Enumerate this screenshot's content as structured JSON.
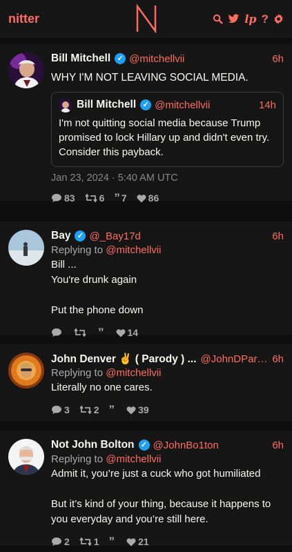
{
  "nav": {
    "brand": "nitter",
    "logo_letter": "N",
    "icons": [
      "search-icon",
      "twitter-bird-icon",
      "lp-icon",
      "help-icon",
      "settings-gear-icon"
    ],
    "lp_label": "lp",
    "help_label": "?"
  },
  "colors": {
    "accent": "#ff6c60",
    "verified": "#1da1f2",
    "bg": "#0f0f0f",
    "card": "#161616"
  },
  "tweets": [
    {
      "fullname": "Bill Mitchell",
      "username": "@mitchellvii",
      "time": "6h",
      "text": "WHY I'M NOT LEAVING SOCIAL MEDIA.",
      "quote": {
        "fullname": "Bill Mitchell",
        "username": "@mitchellvii",
        "time": "14h",
        "text": "I'm not quitting social media because Trump promised to lock Hillary up and didn't even try. Consider this payback."
      },
      "date": "Jan 23, 2024 · 5:40 AM UTC",
      "stats": {
        "replies": "83",
        "retweets": "6",
        "quotes": "7",
        "likes": "86"
      }
    },
    {
      "fullname": "Bay",
      "username": "@_Bay17d",
      "time": "6h",
      "replying_label": "Replying to",
      "replying_to": "@mitchellvii",
      "lines": [
        "Bill ...",
        "You're drunk again",
        "",
        "Put the phone down"
      ],
      "stats": {
        "replies": "",
        "retweets": "",
        "quotes": "",
        "likes": "14"
      }
    },
    {
      "fullname": "John Denver ✌️ ( Parody ) ...",
      "username": "@JohnDParo…",
      "time": "6h",
      "replying_label": "Replying to",
      "replying_to": "@mitchellvii",
      "lines": [
        "Literally no one cares."
      ],
      "stats": {
        "replies": "3",
        "retweets": "2",
        "quotes": "",
        "likes": "39"
      }
    },
    {
      "fullname": "Not John Bolton",
      "username": "@JohnBo1ton",
      "time": "6h",
      "replying_label": "Replying to",
      "replying_to": "@mitchellvii",
      "lines": [
        "Admit it, you’re just a cuck who got humiliated",
        "",
        "But it’s kind of your thing, because it happens to you everyday and you’re still here."
      ],
      "stats": {
        "replies": "2",
        "retweets": "1",
        "quotes": "",
        "likes": "21"
      }
    }
  ]
}
